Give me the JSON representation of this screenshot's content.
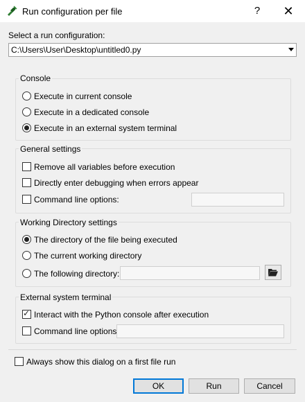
{
  "window": {
    "title": "Run configuration per file",
    "help_label": "?",
    "close_label": "✕"
  },
  "select": {
    "label": "Select a run configuration:",
    "value": "C:\\Users\\User\\Desktop\\untitled0.py"
  },
  "console": {
    "title": "Console",
    "options": [
      {
        "label": "Execute in current console",
        "checked": false
      },
      {
        "label": "Execute in a dedicated console",
        "checked": false
      },
      {
        "label": "Execute in an external system terminal",
        "checked": true
      }
    ]
  },
  "general": {
    "title": "General settings",
    "options": [
      {
        "label": "Remove all variables before execution",
        "checked": false
      },
      {
        "label": "Directly enter debugging when errors appear",
        "checked": false
      },
      {
        "label": "Command line options:",
        "checked": false
      }
    ],
    "cmd_value": ""
  },
  "workdir": {
    "title": "Working Directory settings",
    "options": [
      {
        "label": "The directory of the file being executed",
        "checked": true
      },
      {
        "label": "The current working directory",
        "checked": false
      },
      {
        "label": "The following directory:",
        "checked": false
      }
    ],
    "dir_value": "",
    "browse_icon": "folder-open-icon"
  },
  "external": {
    "title": "External system terminal",
    "options": [
      {
        "label": "Interact with the Python console after execution",
        "checked": true
      },
      {
        "label": "Command line options:",
        "checked": false
      }
    ],
    "cmd_value": ""
  },
  "always_show": {
    "label": "Always show this dialog on a first file run",
    "checked": false
  },
  "buttons": {
    "ok": "OK",
    "run": "Run",
    "cancel": "Cancel"
  },
  "colors": {
    "default_button_border": "#0078d7"
  }
}
